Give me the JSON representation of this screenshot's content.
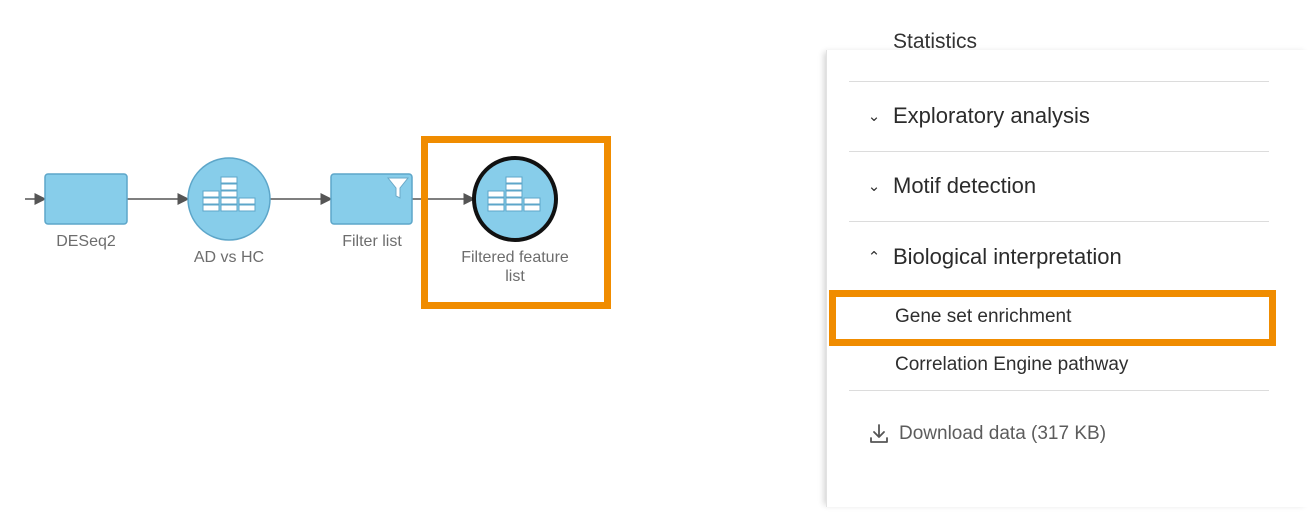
{
  "pipeline": {
    "nodes": [
      {
        "label": "DESeq2"
      },
      {
        "label": "AD vs HC"
      },
      {
        "label": "Filter list"
      },
      {
        "label": "Filtered feature\nlist"
      }
    ]
  },
  "panel": {
    "partial_section": "Statistics",
    "sections": [
      {
        "label": "Exploratory analysis",
        "state": "collapsed",
        "chevron": "chevron-down-icon"
      },
      {
        "label": "Motif detection",
        "state": "collapsed",
        "chevron": "chevron-down-icon"
      },
      {
        "label": "Biological interpretation",
        "state": "expanded",
        "chevron": "chevron-up-icon"
      }
    ],
    "bio_items": [
      {
        "label": "Gene set enrichment",
        "highlighted": true
      },
      {
        "label": "Correlation Engine pathway",
        "highlighted": false
      }
    ],
    "download_label": "Download data (317 KB)"
  },
  "colors": {
    "highlight": "#f08c00",
    "node_fill": "#87cdea",
    "node_stroke": "#5da6c9"
  }
}
